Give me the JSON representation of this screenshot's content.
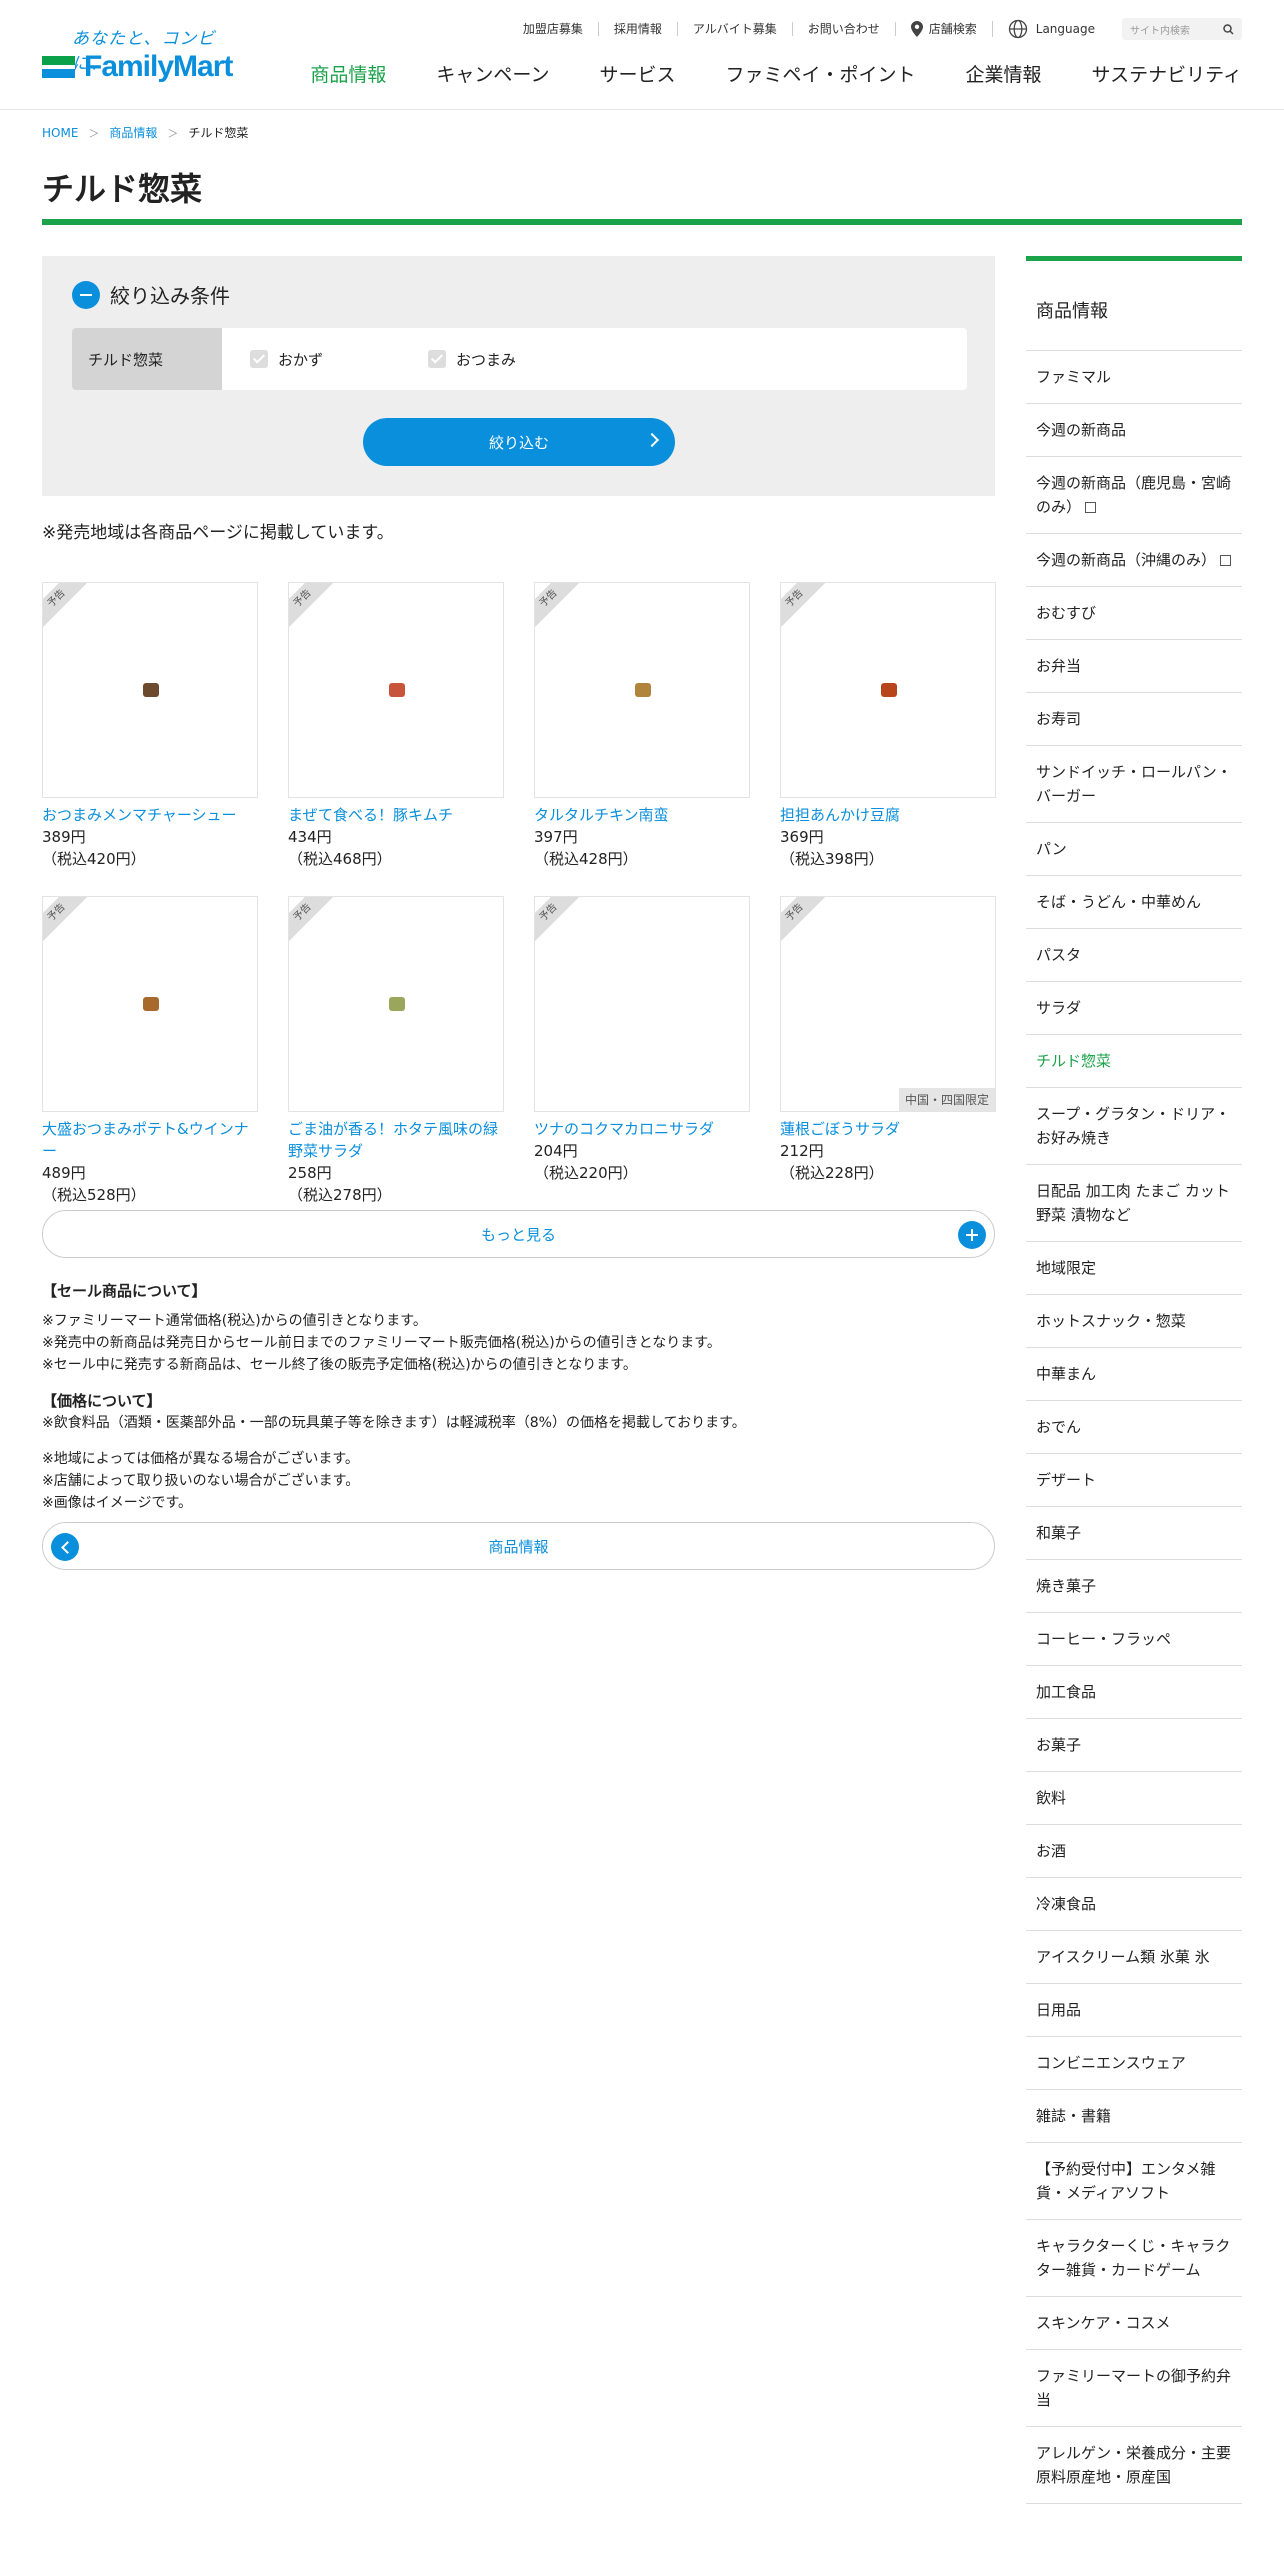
{
  "header": {
    "tagline": "あなたと、コンビに、",
    "brand": "FamilyMart",
    "util_links": [
      "加盟店募集",
      "採用情報",
      "アルバイト募集",
      "お問い合わせ"
    ],
    "store_search": "店舗検索",
    "language": "Language",
    "search_placeholder": "サイト内検索",
    "nav": [
      "商品情報",
      "キャンペーン",
      "サービス",
      "ファミペイ・ポイント",
      "企業情報",
      "サステナビリティ"
    ]
  },
  "breadcrumb": [
    "HOME",
    "商品情報",
    "チルド惣菜"
  ],
  "page_title": "チルド惣菜",
  "filter": {
    "heading": "絞り込み条件",
    "category": "チルド惣菜",
    "options": [
      "おかず",
      "おつまみ"
    ],
    "button": "絞り込む"
  },
  "note_region": "※発売地域は各商品ページに掲載しています。",
  "products": [
    {
      "name": "おつまみメンマチャーシュー",
      "price": "389円",
      "tax": "（税込420円）",
      "tag": "予告",
      "region": "",
      "thumb_color": "#6b4a2e"
    },
    {
      "name": "まぜて食べる！豚キムチ",
      "price": "434円",
      "tax": "（税込468円）",
      "tag": "予告",
      "region": "",
      "thumb_color": "#c8553a"
    },
    {
      "name": "タルタルチキン南蛮",
      "price": "397円",
      "tax": "（税込428円）",
      "tag": "予告",
      "region": "",
      "thumb_color": "#b0843a"
    },
    {
      "name": "担担あんかけ豆腐",
      "price": "369円",
      "tax": "（税込398円）",
      "tag": "予告",
      "region": "",
      "thumb_color": "#b8441c"
    },
    {
      "name": "大盛おつまみポテト&ウインナー",
      "price": "489円",
      "tax": "（税込528円）",
      "tag": "予告",
      "region": "",
      "thumb_color": "#a86a2c"
    },
    {
      "name": "ごま油が香る！ホタテ風味の緑野菜サラダ",
      "price": "258円",
      "tax": "（税込278円）",
      "tag": "予告",
      "region": "",
      "thumb_color": "#9aa65c"
    },
    {
      "name": "ツナのコクマカロニサラダ",
      "price": "204円",
      "tax": "（税込220円）",
      "tag": "予告",
      "region": "",
      "thumb_color": ""
    },
    {
      "name": "蓮根ごぼうサラダ",
      "price": "212円",
      "tax": "（税込228円）",
      "tag": "予告",
      "region": "中国・四国限定",
      "thumb_color": ""
    }
  ],
  "more_button": "もっと見る",
  "notes": {
    "sale_heading": "【セール商品について】",
    "sale_lines": [
      "※ファミリーマート通常価格(税込)からの値引きとなります。",
      "※発売中の新商品は発売日からセール前日までのファミリーマート販売価格(税込)からの値引きとなります。",
      "※セール中に発売する新商品は、セール終了後の販売予定価格(税込)からの値引きとなります。"
    ],
    "price_heading": "【価格について】",
    "price_lines": [
      "※飲食料品（酒類・医薬部外品・一部の玩具菓子等を除きます）は軽減税率（8%）の価格を掲載しております。"
    ],
    "misc_lines": [
      "※地域によっては価格が異なる場合がございます。",
      "※店舗によって取り扱いのない場合がございます。",
      "※画像はイメージです。"
    ]
  },
  "back_button": "商品情報",
  "sidebar": {
    "heading": "商品情報",
    "items": [
      {
        "label": "ファミマル",
        "external": false,
        "active": false
      },
      {
        "label": "今週の新商品",
        "external": false,
        "active": false
      },
      {
        "label": "今週の新商品（鹿児島・宮崎のみ）",
        "external": true,
        "active": false
      },
      {
        "label": "今週の新商品（沖縄のみ）",
        "external": true,
        "active": false
      },
      {
        "label": "おむすび",
        "external": false,
        "active": false
      },
      {
        "label": "お弁当",
        "external": false,
        "active": false
      },
      {
        "label": "お寿司",
        "external": false,
        "active": false
      },
      {
        "label": "サンドイッチ・ロールパン・バーガー",
        "external": false,
        "active": false
      },
      {
        "label": "パン",
        "external": false,
        "active": false
      },
      {
        "label": "そば・うどん・中華めん",
        "external": false,
        "active": false
      },
      {
        "label": "パスタ",
        "external": false,
        "active": false
      },
      {
        "label": "サラダ",
        "external": false,
        "active": false
      },
      {
        "label": "チルド惣菜",
        "external": false,
        "active": true
      },
      {
        "label": "スープ・グラタン・ドリア・お好み焼き",
        "external": false,
        "active": false
      },
      {
        "label": "日配品 加工肉 たまご カット野菜 漬物など",
        "external": false,
        "active": false
      },
      {
        "label": "地域限定",
        "external": false,
        "active": false
      },
      {
        "label": "ホットスナック・惣菜",
        "external": false,
        "active": false
      },
      {
        "label": "中華まん",
        "external": false,
        "active": false
      },
      {
        "label": "おでん",
        "external": false,
        "active": false
      },
      {
        "label": "デザート",
        "external": false,
        "active": false
      },
      {
        "label": "和菓子",
        "external": false,
        "active": false
      },
      {
        "label": "焼き菓子",
        "external": false,
        "active": false
      },
      {
        "label": "コーヒー・フラッペ",
        "external": false,
        "active": false
      },
      {
        "label": "加工食品",
        "external": false,
        "active": false
      },
      {
        "label": "お菓子",
        "external": false,
        "active": false
      },
      {
        "label": "飲料",
        "external": false,
        "active": false
      },
      {
        "label": "お酒",
        "external": false,
        "active": false
      },
      {
        "label": "冷凍食品",
        "external": false,
        "active": false
      },
      {
        "label": "アイスクリーム類 氷菓 氷",
        "external": false,
        "active": false
      },
      {
        "label": "日用品",
        "external": false,
        "active": false
      },
      {
        "label": "コンビニエンスウェア",
        "external": false,
        "active": false
      },
      {
        "label": "雑誌・書籍",
        "external": false,
        "active": false
      },
      {
        "label": "【予約受付中】エンタメ雑貨・メディアソフト",
        "external": false,
        "active": false
      },
      {
        "label": "キャラクターくじ・キャラクター雑貨・カードゲーム",
        "external": false,
        "active": false
      },
      {
        "label": "スキンケア・コスメ",
        "external": false,
        "active": false
      },
      {
        "label": "ファミリーマートの御予約弁当",
        "external": false,
        "active": false
      },
      {
        "label": "アレルゲン・栄養成分・主要原料原産地・原産国",
        "external": false,
        "active": false
      }
    ]
  },
  "colors": {
    "accent_green": "#1ba34a",
    "accent_blue": "#0a8fdc"
  }
}
